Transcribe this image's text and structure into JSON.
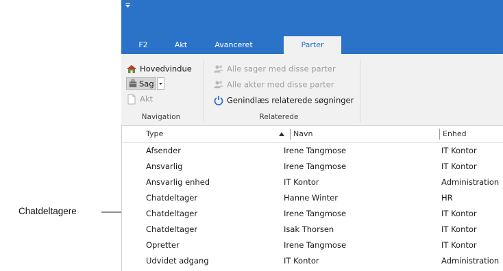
{
  "ribbon": {
    "tabs": [
      {
        "label": "F2",
        "active": false
      },
      {
        "label": "Akt",
        "active": false
      },
      {
        "label": "Avanceret",
        "active": false
      },
      {
        "label": "Parter",
        "active": true
      }
    ],
    "navigation": {
      "label": "Navigation",
      "buttons": [
        {
          "label": "Hovedvindue",
          "icon": "home-icon",
          "enabled": true
        },
        {
          "label": "Sag",
          "icon": "case-icon",
          "enabled": true
        },
        {
          "label": "Akt",
          "icon": "document-icon",
          "enabled": false
        }
      ]
    },
    "related": {
      "label": "Relaterede",
      "buttons": [
        {
          "label": "Alle sager med disse parter",
          "icon": "people-icon",
          "enabled": false
        },
        {
          "label": "Alle akter med disse parter",
          "icon": "people-icon",
          "enabled": false
        },
        {
          "label": "Genindlæs relaterede søgninger",
          "icon": "refresh-icon",
          "enabled": true
        }
      ]
    }
  },
  "grid": {
    "columns": [
      "Type",
      "Navn",
      "Enhed"
    ],
    "sort": {
      "column": "Type",
      "direction": "ascending"
    },
    "rows": [
      {
        "type": "Afsender",
        "name": "Irene Tangmose",
        "unit": "IT Kontor"
      },
      {
        "type": "Ansvarlig",
        "name": "Irene Tangmose",
        "unit": "IT Kontor"
      },
      {
        "type": "Ansvarlig enhed",
        "name": "IT Kontor",
        "unit": "Administration"
      },
      {
        "type": "Chatdeltager",
        "name": "Hanne Winter",
        "unit": "HR"
      },
      {
        "type": "Chatdeltager",
        "name": "Irene Tangmose",
        "unit": "IT Kontor"
      },
      {
        "type": "Chatdeltager",
        "name": "Isak Thorsen",
        "unit": "IT Kontor"
      },
      {
        "type": "Opretter",
        "name": "Irene Tangmose",
        "unit": "IT Kontor"
      },
      {
        "type": "Udvidet adgang",
        "name": "IT Kontor",
        "unit": "Administration"
      }
    ]
  },
  "annotation": {
    "label": "Chatdeltagere"
  },
  "colors": {
    "ribbon_blue": "#2b73c9",
    "ribbon_background": "#f1f1f1",
    "disabled_text": "#a0a0a0"
  }
}
